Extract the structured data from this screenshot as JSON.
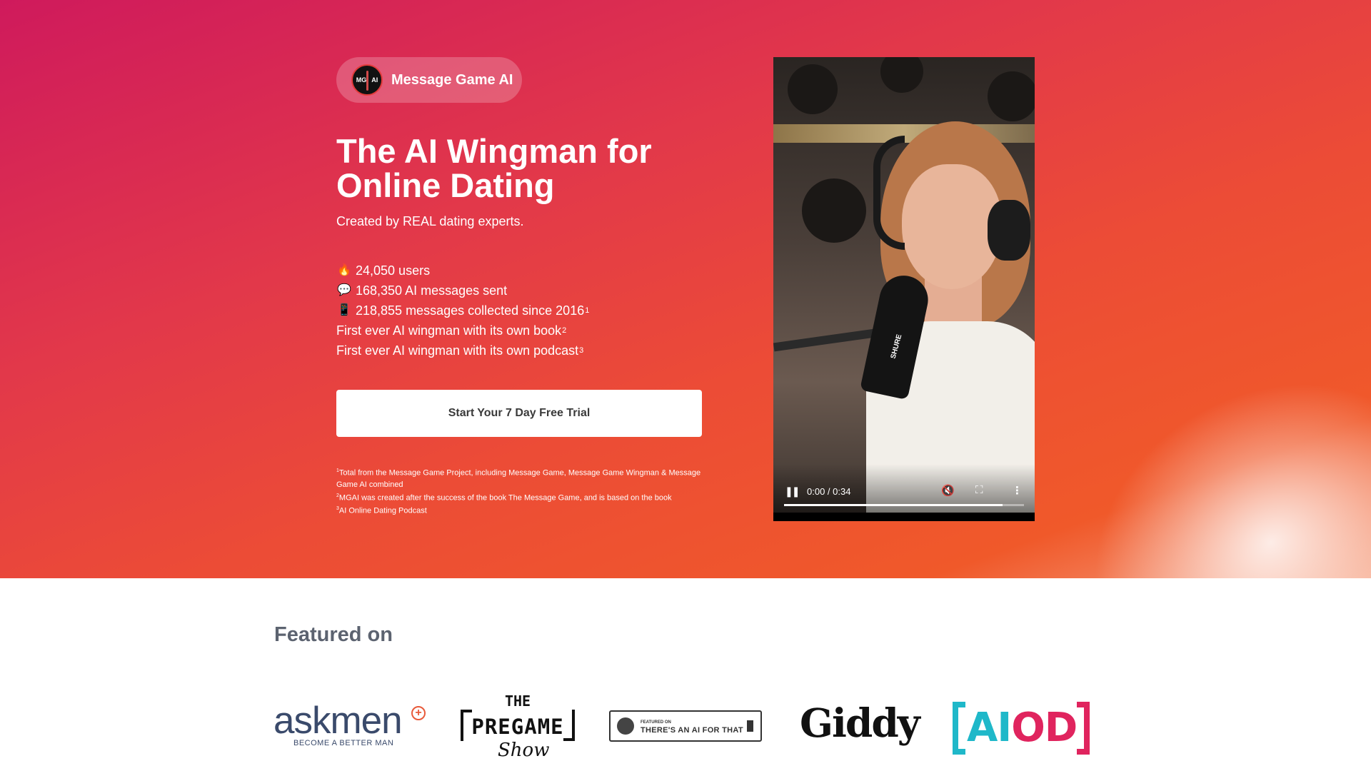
{
  "brand": {
    "name": "Message Game AI",
    "logo_left": "MG",
    "logo_right": "AI"
  },
  "hero": {
    "headline": "The AI Wingman for Online Dating",
    "subhead": "Created by REAL dating experts.",
    "stats": [
      {
        "icon": "fire-icon",
        "glyph": "🔥",
        "text": "24,050 users",
        "sup": ""
      },
      {
        "icon": "speech-bubble-icon",
        "glyph": "💬",
        "text": "168,350 AI messages sent",
        "sup": ""
      },
      {
        "icon": "mobile-phone-icon",
        "glyph": "📱",
        "text": "218,855 messages collected since 2016",
        "sup": "1"
      },
      {
        "icon": "",
        "glyph": "",
        "text": "First ever AI wingman with its own book",
        "sup": "2"
      },
      {
        "icon": "",
        "glyph": "",
        "text": "First ever AI wingman with its own podcast",
        "sup": "3"
      }
    ],
    "cta_label": "Start Your 7 Day Free Trial",
    "footnotes": [
      {
        "num": "1",
        "text": "Total from the Message Game Project, including Message Game, Message Game Wingman & Message Game AI combined"
      },
      {
        "num": "2",
        "text": "MGAI was created after the success of the book The Message Game, and is based on the book"
      },
      {
        "num": "3",
        "text": "AI Online Dating Podcast"
      }
    ]
  },
  "video": {
    "current_time": "0:00",
    "duration": "0:34",
    "time_display": "0:00 / 0:34",
    "progress": 0.91,
    "mic_label": "SHURE",
    "muted": true
  },
  "featured": {
    "title": "Featured on",
    "logos": {
      "askmen": {
        "word": "askmen",
        "tagline": "BECOME A BETTER MAN"
      },
      "pregame": {
        "the": "THE",
        "word": "PREGAME",
        "show": "Show"
      },
      "aiforthat": {
        "small": "FEATURED ON",
        "text": "THERE'S AN AI FOR THAT"
      },
      "giddy": {
        "word": "Giddy"
      },
      "aiod": {
        "part1": "AI",
        "part2": "OD"
      }
    }
  },
  "colors": {
    "hero_start": "#cf1a5c",
    "hero_end": "#f0592a",
    "heading_gray": "#5c6370"
  }
}
